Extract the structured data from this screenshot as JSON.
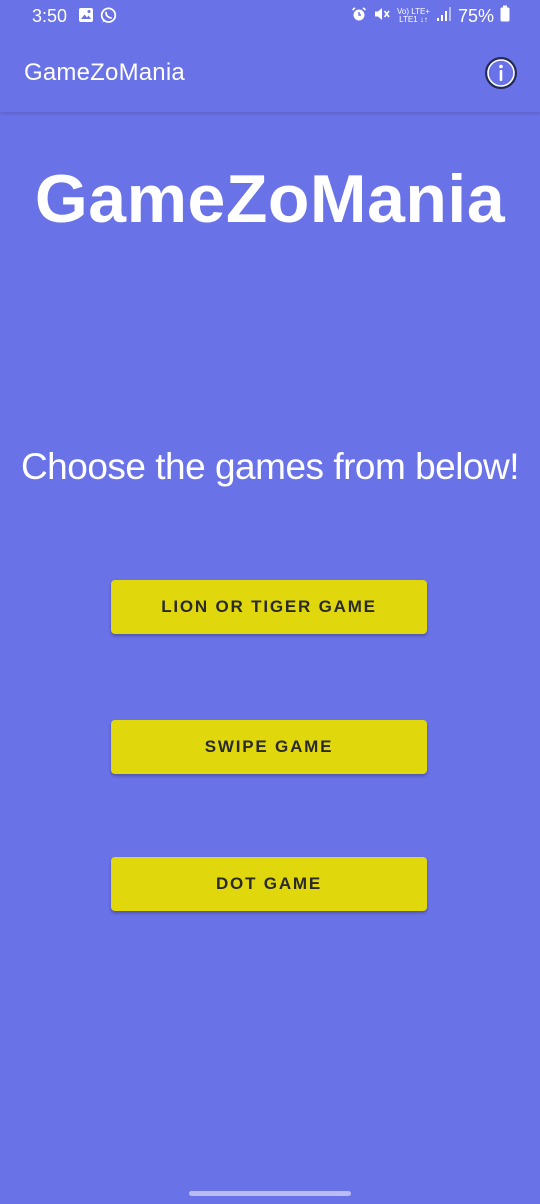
{
  "status_bar": {
    "time": "3:50",
    "network_top": "Vo) LTE+",
    "network_bottom": "LTE1 ↓↑",
    "battery": "75%"
  },
  "app_bar": {
    "title": "GameZoMania",
    "info_icon": "info-icon"
  },
  "main": {
    "hero_title": "GameZoMania",
    "subtitle": "Choose the games from below!",
    "buttons": [
      {
        "label": "LION OR TIGER GAME"
      },
      {
        "label": "SWIPE GAME"
      },
      {
        "label": "DOT GAME"
      }
    ]
  },
  "colors": {
    "background": "#6a72e8",
    "button": "#e0d80c",
    "button_text": "#2a2a2a",
    "text": "#ffffff"
  }
}
